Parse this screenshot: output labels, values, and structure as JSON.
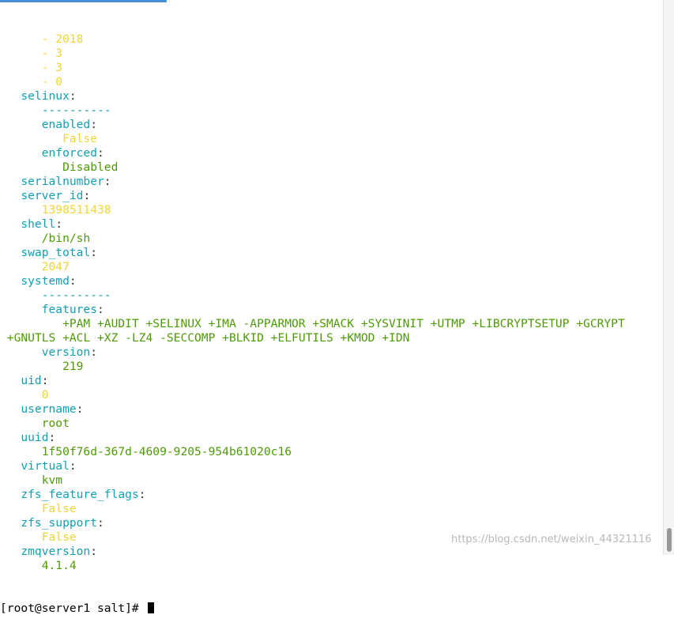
{
  "terminal": {
    "lines": [
      [
        {
          "t": "      ",
          "c": "p"
        },
        {
          "t": "- 2018",
          "c": "n"
        }
      ],
      [
        {
          "t": "      ",
          "c": "p"
        },
        {
          "t": "- 3",
          "c": "n"
        }
      ],
      [
        {
          "t": "      ",
          "c": "p"
        },
        {
          "t": "- 3",
          "c": "n"
        }
      ],
      [
        {
          "t": "      ",
          "c": "p"
        },
        {
          "t": "- 0",
          "c": "n"
        }
      ],
      [
        {
          "t": "   ",
          "c": "p"
        },
        {
          "t": "selinux",
          "c": "k"
        },
        {
          "t": ":",
          "c": "p"
        }
      ],
      [
        {
          "t": "      ",
          "c": "p"
        },
        {
          "t": "----------",
          "c": "d"
        }
      ],
      [
        {
          "t": "      ",
          "c": "p"
        },
        {
          "t": "enabled",
          "c": "k"
        },
        {
          "t": ":",
          "c": "p"
        }
      ],
      [
        {
          "t": "         ",
          "c": "p"
        },
        {
          "t": "False",
          "c": "n"
        }
      ],
      [
        {
          "t": "      ",
          "c": "p"
        },
        {
          "t": "enforced",
          "c": "k"
        },
        {
          "t": ":",
          "c": "p"
        }
      ],
      [
        {
          "t": "         ",
          "c": "p"
        },
        {
          "t": "Disabled",
          "c": "v"
        }
      ],
      [
        {
          "t": "   ",
          "c": "p"
        },
        {
          "t": "serialnumber",
          "c": "k"
        },
        {
          "t": ":",
          "c": "p"
        }
      ],
      [
        {
          "t": "   ",
          "c": "p"
        },
        {
          "t": "server_id",
          "c": "k"
        },
        {
          "t": ":",
          "c": "p"
        }
      ],
      [
        {
          "t": "      ",
          "c": "p"
        },
        {
          "t": "1398511438",
          "c": "n"
        }
      ],
      [
        {
          "t": "   ",
          "c": "p"
        },
        {
          "t": "shell",
          "c": "k"
        },
        {
          "t": ":",
          "c": "p"
        }
      ],
      [
        {
          "t": "      ",
          "c": "p"
        },
        {
          "t": "/bin/sh",
          "c": "v"
        }
      ],
      [
        {
          "t": "   ",
          "c": "p"
        },
        {
          "t": "swap_total",
          "c": "k"
        },
        {
          "t": ":",
          "c": "p"
        }
      ],
      [
        {
          "t": "      ",
          "c": "p"
        },
        {
          "t": "2047",
          "c": "n"
        }
      ],
      [
        {
          "t": "   ",
          "c": "p"
        },
        {
          "t": "systemd",
          "c": "k"
        },
        {
          "t": ":",
          "c": "p"
        }
      ],
      [
        {
          "t": "      ",
          "c": "p"
        },
        {
          "t": "----------",
          "c": "d"
        }
      ],
      [
        {
          "t": "      ",
          "c": "p"
        },
        {
          "t": "features",
          "c": "k"
        },
        {
          "t": ":",
          "c": "p"
        }
      ],
      [
        {
          "t": "         ",
          "c": "p"
        },
        {
          "t": "+PAM +AUDIT +SELINUX +IMA -APPARMOR +SMACK +SYSVINIT +UTMP +LIBCRYPTSETUP +GCRYPT",
          "c": "v"
        }
      ],
      [
        {
          "t": " ",
          "c": "p"
        },
        {
          "t": "+GNUTLS +ACL +XZ -LZ4 -SECCOMP +BLKID +ELFUTILS +KMOD +IDN",
          "c": "v"
        }
      ],
      [
        {
          "t": "      ",
          "c": "p"
        },
        {
          "t": "version",
          "c": "k"
        },
        {
          "t": ":",
          "c": "p"
        }
      ],
      [
        {
          "t": "         ",
          "c": "p"
        },
        {
          "t": "219",
          "c": "v"
        }
      ],
      [
        {
          "t": "   ",
          "c": "p"
        },
        {
          "t": "uid",
          "c": "k"
        },
        {
          "t": ":",
          "c": "p"
        }
      ],
      [
        {
          "t": "      ",
          "c": "p"
        },
        {
          "t": "0",
          "c": "n"
        }
      ],
      [
        {
          "t": "   ",
          "c": "p"
        },
        {
          "t": "username",
          "c": "k"
        },
        {
          "t": ":",
          "c": "p"
        }
      ],
      [
        {
          "t": "      ",
          "c": "p"
        },
        {
          "t": "root",
          "c": "v"
        }
      ],
      [
        {
          "t": "   ",
          "c": "p"
        },
        {
          "t": "uuid",
          "c": "k"
        },
        {
          "t": ":",
          "c": "p"
        }
      ],
      [
        {
          "t": "      ",
          "c": "p"
        },
        {
          "t": "1f50f76d-367d-4609-9205-954b61020c16",
          "c": "v"
        }
      ],
      [
        {
          "t": "   ",
          "c": "p"
        },
        {
          "t": "virtual",
          "c": "k"
        },
        {
          "t": ":",
          "c": "p"
        }
      ],
      [
        {
          "t": "      ",
          "c": "p"
        },
        {
          "t": "kvm",
          "c": "v"
        }
      ],
      [
        {
          "t": "   ",
          "c": "p"
        },
        {
          "t": "zfs_feature_flags",
          "c": "k"
        },
        {
          "t": ":",
          "c": "p"
        }
      ],
      [
        {
          "t": "      ",
          "c": "p"
        },
        {
          "t": "False",
          "c": "n"
        }
      ],
      [
        {
          "t": "   ",
          "c": "p"
        },
        {
          "t": "zfs_support",
          "c": "k"
        },
        {
          "t": ":",
          "c": "p"
        }
      ],
      [
        {
          "t": "      ",
          "c": "p"
        },
        {
          "t": "False",
          "c": "n"
        }
      ],
      [
        {
          "t": "   ",
          "c": "p"
        },
        {
          "t": "zmqversion",
          "c": "k"
        },
        {
          "t": ":",
          "c": "p"
        }
      ],
      [
        {
          "t": "      ",
          "c": "p"
        },
        {
          "t": "4.1.4",
          "c": "v"
        }
      ]
    ],
    "prompt": "[root@server1 salt]# "
  },
  "watermark": "https://blog.csdn.net/weixin_44321116",
  "colors": {
    "key": "#11a0b3",
    "string_value": "#4e9a06",
    "number_value": "#f0d43a",
    "tab_accent": "#4a90d9"
  }
}
